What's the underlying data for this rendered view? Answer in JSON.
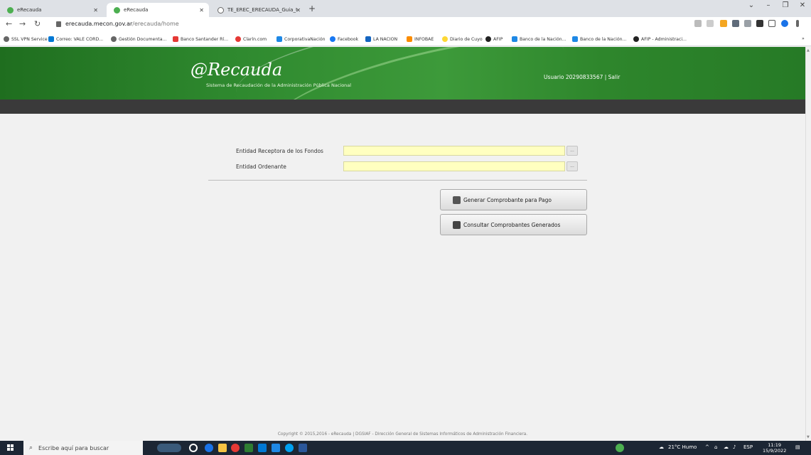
{
  "browser": {
    "tabs": [
      {
        "label": "eRecauda",
        "active": false
      },
      {
        "label": "eRecauda",
        "active": true
      },
      {
        "label": "TE_EREC_ERECAUDA_Guia_Usuar",
        "active": false
      }
    ],
    "new_tab": "+",
    "url_host": "erecauda.mecon.gov.ar",
    "url_path": "/erecauda/home",
    "bookmarks": [
      "SSL VPN Service",
      "Correo: VALE CORD...",
      "Gestión Documenta...",
      "Banco Santander Rí...",
      "Clarín.com",
      "CorporativaNación",
      "Facebook",
      "LA NACION",
      "INFOBAE",
      "Diario de Cuyo",
      "AFIP",
      "Banco de la Nación...",
      "Banco de la Nación...",
      "AFIP - Administraci..."
    ],
    "bookmarks_more": "»"
  },
  "header": {
    "logo": "@Recauda",
    "subtitle": "Sistema de Recaudación de la Administración Pública Nacional",
    "user_text": "Usuario 20290833567 | Salir"
  },
  "form": {
    "entidad_receptora_label": "Entidad Receptora de los Fondos",
    "entidad_receptora_value": "",
    "entidad_ordenante_label": "Entidad Ordenante",
    "entidad_ordenante_value": "",
    "lookup_label": "..."
  },
  "actions": {
    "generar_label": "Generar Comprobante para Pago",
    "consultar_label": "Consultar Comprobantes Generados"
  },
  "footer": {
    "text": "Copyright © 2015,2016 - eRecauda | DGSIAF - Dirección General de Sistemas Informáticos de Administración Financiera."
  },
  "taskbar": {
    "search_placeholder": "Escribe aquí para buscar",
    "weather": "21°C Humo",
    "lang": "ESP",
    "time": "11:19",
    "date": "15/9/2022"
  },
  "colors": {
    "header_green": "#2f8a2f",
    "input_yellow": "#ffffc0",
    "dark_bar": "#3a3a3a"
  }
}
